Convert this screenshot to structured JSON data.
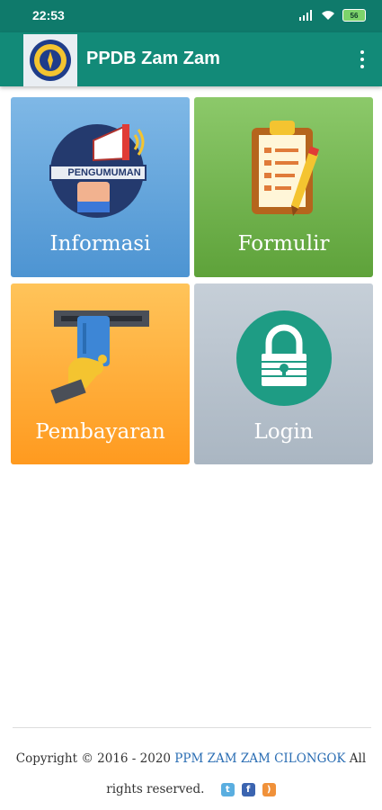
{
  "status_bar": {
    "time": "22:53",
    "battery": "56"
  },
  "app_bar": {
    "title": "PPDB Zam Zam"
  },
  "tiles": [
    {
      "label": "Informasi",
      "icon": "megaphone-icon",
      "banner": "PENGUMUMAN"
    },
    {
      "label": "Formulir",
      "icon": "clipboard-icon"
    },
    {
      "label": "Pembayaran",
      "icon": "card-payment-icon"
    },
    {
      "label": "Login",
      "icon": "lock-icon"
    }
  ],
  "footer": {
    "prefix": "Copyright © 2016 - 2020 ",
    "link": "PPM ZAM ZAM CILONGOK",
    "suffix_1": " All",
    "line2": "rights reserved.",
    "social_icons": [
      "twitter-icon",
      "facebook-icon",
      "rss-icon"
    ]
  },
  "colors": {
    "status_bar": "#0f7a6b",
    "app_bar": "#128a78",
    "informasi": "#5aa0da",
    "formulir": "#6fb04a",
    "pembayaran": "#ffab38",
    "login": "#b6c1cc",
    "footer_link": "#2a6db3"
  }
}
